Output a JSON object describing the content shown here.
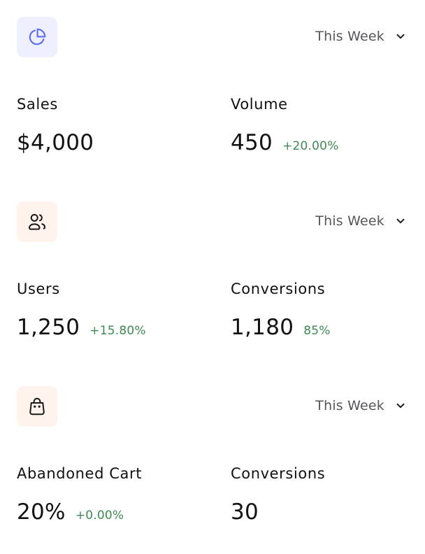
{
  "colors": {
    "tile_blue": "#eef0ff",
    "tile_peach": "#fff3ec",
    "icon_blue": "#5b6df0",
    "icon_dark": "#1a1a1a",
    "change_green": "#3f8a55",
    "muted_text": "#55555b"
  },
  "cards": [
    {
      "icon": "pie-chart-icon",
      "period": "This Week",
      "metrics": [
        {
          "label": "Sales",
          "value": "$4,000",
          "change": ""
        },
        {
          "label": "Volume",
          "value": "450",
          "change": "+20.00%"
        }
      ]
    },
    {
      "icon": "users-icon",
      "period": "This Week",
      "metrics": [
        {
          "label": "Users",
          "value": "1,250",
          "change": "+15.80%"
        },
        {
          "label": "Conversions",
          "value": "1,180",
          "change": "85%"
        }
      ]
    },
    {
      "icon": "shopping-bag-icon",
      "period": "This Week",
      "metrics": [
        {
          "label": "Abandoned Cart",
          "value": "20%",
          "change": "+0.00%"
        },
        {
          "label": "Conversions",
          "value": "30",
          "change": ""
        }
      ]
    }
  ]
}
